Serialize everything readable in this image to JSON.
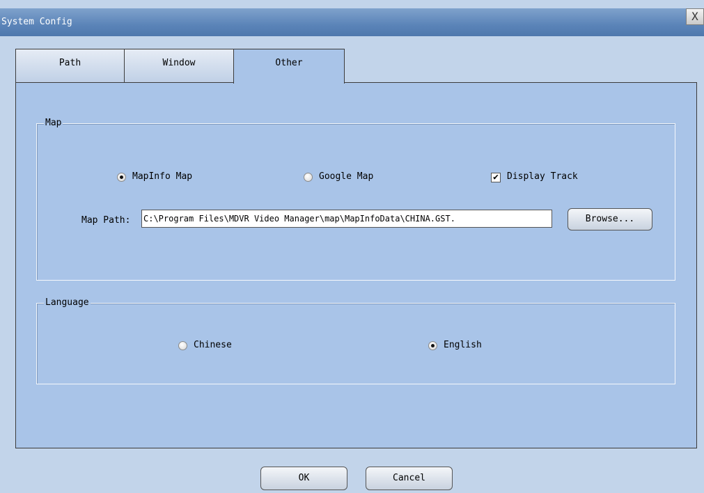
{
  "window": {
    "title": "System Config",
    "close_symbol": "X"
  },
  "tabs": [
    {
      "label": "Path",
      "active": false
    },
    {
      "label": "Window",
      "active": false
    },
    {
      "label": "Other",
      "active": true
    }
  ],
  "map_group": {
    "legend": "Map",
    "options": [
      {
        "label": "MapInfo Map",
        "selected": true
      },
      {
        "label": "Google Map",
        "selected": false
      }
    ],
    "display_track": {
      "label": "Display Track",
      "checked": true
    },
    "map_path_label": "Map Path:",
    "map_path_value": "C:\\Program Files\\MDVR Video Manager\\map\\MapInfoData\\CHINA.GST.",
    "browse_label": "Browse..."
  },
  "language_group": {
    "legend": "Language",
    "options": [
      {
        "label": "Chinese",
        "selected": false
      },
      {
        "label": "English",
        "selected": true
      }
    ]
  },
  "footer": {
    "ok_label": "OK",
    "cancel_label": "Cancel"
  }
}
